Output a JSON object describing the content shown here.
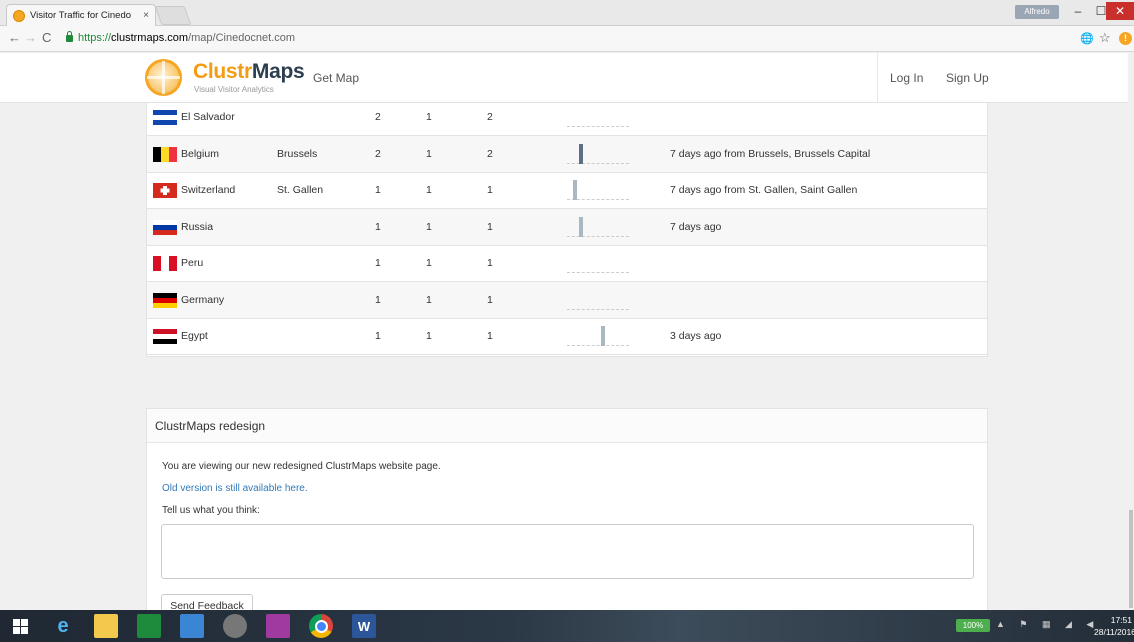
{
  "browser": {
    "tab_title": "Visitor Traffic for Cinedo",
    "tab_close": "×",
    "user_badge": "Alfredo",
    "url_proto": "https://",
    "url_host": "clustrmaps.com",
    "url_path": "/map/Cinedocnet.com",
    "win_min": "–",
    "win_max": "☐",
    "win_close": "✕",
    "back": "←",
    "forward": "→",
    "reload": "C",
    "star": "☆",
    "translate": "🌐",
    "alert": "!"
  },
  "header": {
    "logo_clustr": "Clustr",
    "logo_maps": "Maps",
    "tagline": "Visual Visitor Analytics",
    "nav_getmap": "Get Map",
    "nav_login": "Log In",
    "nav_signup": "Sign Up"
  },
  "countries": [
    {
      "country": "El Salvador",
      "city": "",
      "n1": "2",
      "n2": "1",
      "n3": "2",
      "last": "",
      "flag": "sv",
      "spark": []
    },
    {
      "country": "Belgium",
      "city": "Brussels",
      "n1": "2",
      "n2": "1",
      "n3": "2",
      "last": "7 days ago from Brussels, Brussels Capital",
      "flag": "be",
      "spark": [
        {
          "pos": 0.2,
          "h": 1.0
        }
      ]
    },
    {
      "country": "Switzerland",
      "city": "St. Gallen",
      "n1": "1",
      "n2": "1",
      "n3": "1",
      "last": "7 days ago from St. Gallen, Saint Gallen",
      "flag": "ch",
      "spark": [
        {
          "pos": 0.1,
          "h": 1.0
        }
      ]
    },
    {
      "country": "Russia",
      "city": "",
      "n1": "1",
      "n2": "1",
      "n3": "1",
      "last": "7 days ago",
      "flag": "ru",
      "spark": [
        {
          "pos": 0.2,
          "h": 1.0
        }
      ]
    },
    {
      "country": "Peru",
      "city": "",
      "n1": "1",
      "n2": "1",
      "n3": "1",
      "last": "",
      "flag": "pe",
      "spark": []
    },
    {
      "country": "Germany",
      "city": "",
      "n1": "1",
      "n2": "1",
      "n3": "1",
      "last": "",
      "flag": "de",
      "spark": []
    },
    {
      "country": "Egypt",
      "city": "",
      "n1": "1",
      "n2": "1",
      "n3": "1",
      "last": "3 days ago",
      "flag": "eg",
      "spark": [
        {
          "pos": 0.58,
          "h": 1.0
        }
      ]
    }
  ],
  "feedback": {
    "title": "ClustrMaps redesign",
    "line1": "You are viewing our new redesigned ClustrMaps website page.",
    "link": "Old version is still available here.",
    "ask": "Tell us what you think:",
    "textarea_value": "",
    "send": "Send Feedback"
  },
  "taskbar": {
    "battery": "100%",
    "tray": "▲ ⚑ ▦ ◢ ◀",
    "time": "17:51",
    "date": "28/11/2016",
    "word_label": "W"
  }
}
